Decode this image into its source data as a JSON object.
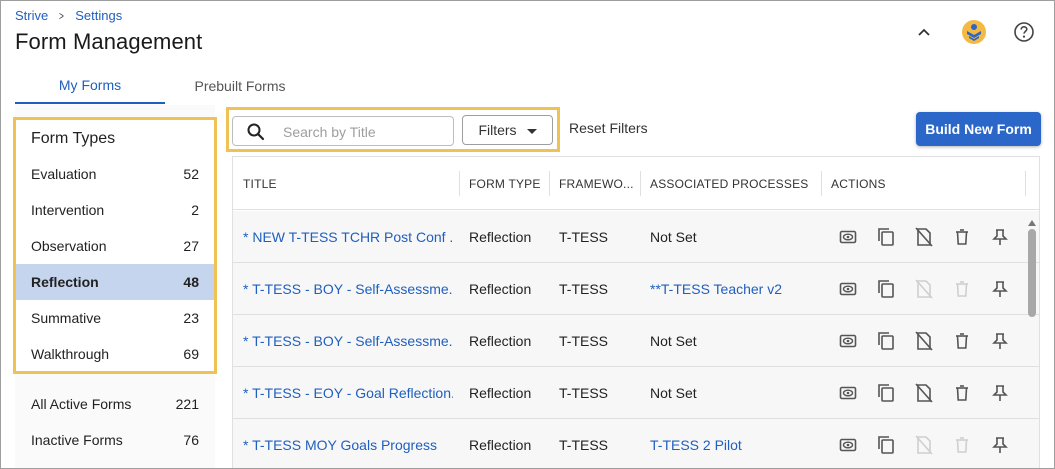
{
  "breadcrumb": {
    "root": "Strive",
    "current": "Settings"
  },
  "page": {
    "title": "Form Management"
  },
  "header_icons": [
    "chevron-up-icon",
    "brand-logo-icon",
    "help-icon"
  ],
  "tabs": [
    {
      "label": "My Forms",
      "active": true
    },
    {
      "label": "Prebuilt Forms",
      "active": false
    }
  ],
  "form_types": {
    "title": "Form Types",
    "items": [
      {
        "label": "Evaluation",
        "count": "52"
      },
      {
        "label": "Intervention",
        "count": "2"
      },
      {
        "label": "Observation",
        "count": "27"
      },
      {
        "label": "Reflection",
        "count": "48",
        "selected": true
      },
      {
        "label": "Summative",
        "count": "23"
      },
      {
        "label": "Walkthrough",
        "count": "69"
      }
    ]
  },
  "other_lists": [
    {
      "label": "All Active Forms",
      "count": "221"
    },
    {
      "label": "Inactive Forms",
      "count": "76"
    }
  ],
  "search": {
    "placeholder": "Search by Title",
    "value": ""
  },
  "filters": {
    "label": "Filters"
  },
  "reset_filters": {
    "label": "Reset Filters"
  },
  "build_new_form": {
    "label": "Build New Form"
  },
  "table": {
    "columns": [
      "TITLE",
      "FORM TYPE",
      "FRAMEWO...",
      "ASSOCIATED PROCESSES",
      "ACTIONS"
    ],
    "rows": [
      {
        "title": "* NEW T-TESS TCHR Post Conf ...",
        "form_type": "Reflection",
        "framework": "T-TESS",
        "processes": "Not Set",
        "processes_link": false,
        "actions_enabled": [
          true,
          true,
          true,
          true,
          true
        ]
      },
      {
        "title": "* T-TESS - BOY - Self-Assessme...",
        "form_type": "Reflection",
        "framework": "T-TESS",
        "processes": "**T-TESS Teacher v2",
        "processes_link": true,
        "actions_enabled": [
          true,
          true,
          false,
          false,
          true
        ]
      },
      {
        "title": "* T-TESS - BOY - Self-Assessme...",
        "form_type": "Reflection",
        "framework": "T-TESS",
        "processes": "Not Set",
        "processes_link": false,
        "actions_enabled": [
          true,
          true,
          true,
          true,
          true
        ]
      },
      {
        "title": "* T-TESS - EOY - Goal Reflection...",
        "form_type": "Reflection",
        "framework": "T-TESS",
        "processes": "Not Set",
        "processes_link": false,
        "actions_enabled": [
          true,
          true,
          true,
          true,
          true
        ]
      },
      {
        "title": "* T-TESS MOY Goals Progress",
        "form_type": "Reflection",
        "framework": "T-TESS",
        "processes": "T-TESS 2 Pilot",
        "processes_link": true,
        "actions_enabled": [
          true,
          true,
          false,
          false,
          true
        ]
      }
    ]
  },
  "action_icons": [
    "preview-icon",
    "copy-icon",
    "deactivate-icon",
    "delete-icon",
    "pin-icon"
  ],
  "colors": {
    "accent": "#1f5fbf",
    "button": "#2a67c9",
    "highlight": "#f0c254",
    "selected": "#c5d5ee"
  }
}
